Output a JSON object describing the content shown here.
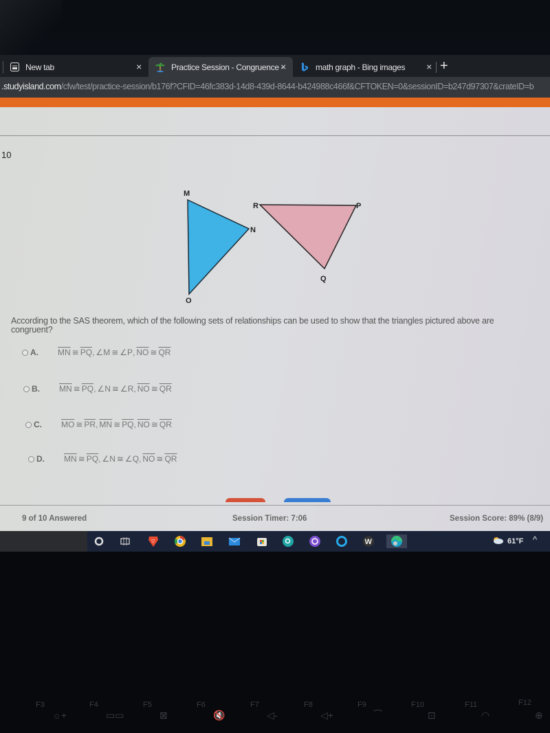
{
  "browser": {
    "tabs": [
      {
        "title": "New tab",
        "icon": "new-tab-page-icon"
      },
      {
        "title": "Practice Session - Congruence - ",
        "icon": "study-island-palm-icon",
        "active": true
      },
      {
        "title": "math graph - Bing images",
        "icon": "bing-icon"
      }
    ],
    "close_glyph": "×",
    "new_tab_glyph": "+",
    "url_host": ".studyisland.com",
    "url_path": "/cfw/test/practice-session/b176f?CFID=46fc383d-14d8-439d-8644-b424988c466f&CFTOKEN=0&sessionID=b247d97307&crateID=b"
  },
  "page": {
    "question_number": "10",
    "figure": {
      "triangle1": {
        "vertices": [
          "M",
          "N",
          "O"
        ],
        "fill": "#3fb2e6"
      },
      "triangle2": {
        "vertices": [
          "R",
          "P",
          "Q"
        ],
        "fill": "#e0a9b3"
      }
    },
    "question_text": "According to the SAS theorem, which of the following sets of relationships can be used to show that the triangles pictured above are congruent?",
    "options": [
      {
        "letter": "A.",
        "parts": [
          {
            "type": "seg",
            "a": "MN",
            "b": "PQ"
          },
          {
            "type": "ang",
            "a": "M",
            "b": "P"
          },
          {
            "type": "seg",
            "a": "NO",
            "b": "QR"
          }
        ]
      },
      {
        "letter": "B.",
        "parts": [
          {
            "type": "seg",
            "a": "MN",
            "b": "PQ"
          },
          {
            "type": "ang",
            "a": "N",
            "b": "R"
          },
          {
            "type": "seg",
            "a": "NO",
            "b": "QR"
          }
        ]
      },
      {
        "letter": "C.",
        "parts": [
          {
            "type": "seg",
            "a": "MO",
            "b": "PR"
          },
          {
            "type": "seg",
            "a": "MN",
            "b": "PQ"
          },
          {
            "type": "seg",
            "a": "NO",
            "b": "QR"
          }
        ]
      },
      {
        "letter": "D.",
        "parts": [
          {
            "type": "seg",
            "a": "MN",
            "b": "PQ"
          },
          {
            "type": "ang",
            "a": "N",
            "b": "Q"
          },
          {
            "type": "seg",
            "a": "NO",
            "b": "QR"
          }
        ]
      }
    ],
    "footer": {
      "answered": "9 of 10 Answered",
      "timer": "Session Timer: 7:06",
      "score": "Session Score: 89% (8/9)"
    },
    "colors": {
      "accent_orange": "#e46a1f",
      "button_red": "#d4533a",
      "button_blue": "#3a7ed4"
    }
  },
  "taskbar": {
    "apps": [
      "search-icon",
      "task-view-icon",
      "brave-icon",
      "chrome-icon",
      "file-explorer-icon",
      "mail-icon",
      "store-icon",
      "zoom-search-icon",
      "app-purple-icon",
      "cortana-icon",
      "w-app-icon",
      "edge-icon"
    ],
    "weather": "61°F",
    "chevron": "^"
  },
  "keyboard": {
    "fkeys": [
      "F3",
      "F4",
      "F5",
      "F6",
      "F7",
      "F8",
      "F9",
      "F10",
      "F11",
      "F12"
    ]
  }
}
